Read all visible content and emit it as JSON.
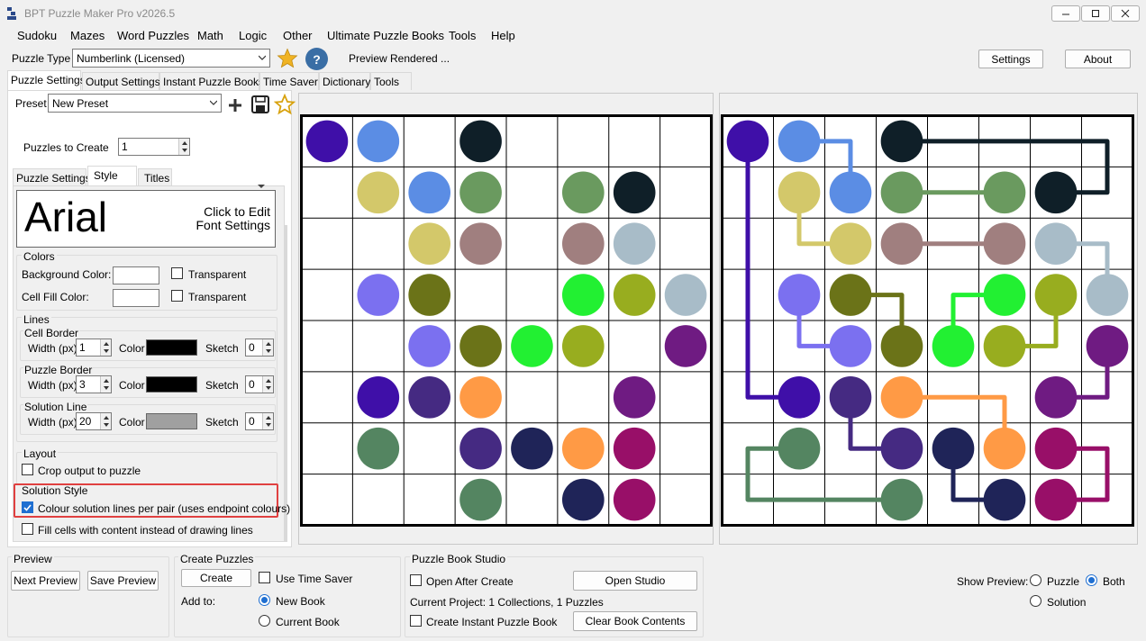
{
  "window": {
    "title": "BPT Puzzle Maker Pro v2026.5"
  },
  "menu": [
    "Sudoku",
    "Mazes",
    "Word Puzzles",
    "Math",
    "Logic",
    "Other",
    "Ultimate Puzzle Books",
    "Tools",
    "Help"
  ],
  "toolbar": {
    "puzzle_type_label": "Puzzle Type",
    "puzzle_type_value": "Numberlink (Licensed)",
    "status": "Preview Rendered ...",
    "settings": "Settings",
    "about": "About"
  },
  "main_tabs": [
    "Puzzle Settings",
    "Output Settings",
    "Instant Puzzle Books",
    "Time Saver",
    "Dictionary",
    "Tools"
  ],
  "preset": {
    "label": "Preset",
    "value": "New Preset"
  },
  "puzzles_to_create": {
    "label": "Puzzles to Create",
    "value": "1"
  },
  "sub_tabs": [
    "Puzzle Settings",
    "Style",
    "Titles"
  ],
  "font": {
    "sample": "Arial",
    "hint1": "Click to Edit",
    "hint2": "Font Settings"
  },
  "colors": {
    "title": "Colors",
    "bg_label": "Background Color:",
    "bg_transparent": "Transparent",
    "fill_label": "Cell Fill Color:",
    "fill_transparent": "Transparent"
  },
  "lines": {
    "title": "Lines",
    "width_label": "Width (px)",
    "color_label": "Color",
    "sketch_label": "Sketch",
    "cell_border": {
      "title": "Cell Border",
      "width": "1",
      "sketch": "0",
      "color": "#000000"
    },
    "puzzle_border": {
      "title": "Puzzle Border",
      "width": "3",
      "sketch": "0",
      "color": "#000000"
    },
    "solution_line": {
      "title": "Solution Line",
      "width": "20",
      "sketch": "0",
      "color": "#a0a0a0"
    }
  },
  "layout": {
    "title": "Layout",
    "crop": "Crop output to puzzle"
  },
  "solution_style": {
    "title": "Solution Style",
    "colour_lines": "Colour solution lines per pair (uses endpoint colours)"
  },
  "fill_cells": "Fill cells with content instead of drawing lines",
  "bottom": {
    "preview_title": "Preview",
    "next_preview": "Next Preview",
    "save_preview": "Save Preview",
    "create_title": "Create Puzzles",
    "create": "Create",
    "use_time_saver": "Use Time Saver",
    "add_to": "Add to:",
    "new_book": "New Book",
    "current_book": "Current Book",
    "studio_title": "Puzzle Book Studio",
    "open_after": "Open After Create",
    "open_studio": "Open Studio",
    "current_project": "Current Project: 1 Collections, 1 Puzzles",
    "create_instant": "Create Instant Puzzle Book",
    "clear_book": "Clear Book Contents",
    "show_preview": "Show Preview:",
    "opt_puzzle": "Puzzle",
    "opt_both": "Both",
    "opt_solution": "Solution"
  },
  "grid": {
    "rows": 8,
    "cols": 8
  },
  "dots": [
    [
      0,
      0,
      "#3f0fa8"
    ],
    [
      0,
      1,
      "#5b8de4"
    ],
    [
      0,
      3,
      "#0f1f28"
    ],
    [
      1,
      1,
      "#d3c86a"
    ],
    [
      1,
      2,
      "#5b8de4"
    ],
    [
      1,
      3,
      "#6a9a5f"
    ],
    [
      1,
      5,
      "#6a9a5f"
    ],
    [
      1,
      6,
      "#0f1f28"
    ],
    [
      2,
      2,
      "#d3c86a"
    ],
    [
      2,
      3,
      "#a07f7f"
    ],
    [
      2,
      5,
      "#a07f7f"
    ],
    [
      2,
      6,
      "#a8bcc8"
    ],
    [
      3,
      1,
      "#7b70f0"
    ],
    [
      3,
      2,
      "#6b7318"
    ],
    [
      3,
      5,
      "#22f032"
    ],
    [
      3,
      6,
      "#98ad1f"
    ],
    [
      3,
      7,
      "#a8bcc8"
    ],
    [
      4,
      2,
      "#7b70f0"
    ],
    [
      4,
      3,
      "#6b7318"
    ],
    [
      4,
      4,
      "#22f032"
    ],
    [
      4,
      5,
      "#98ad1f"
    ],
    [
      4,
      7,
      "#6f1b82"
    ],
    [
      5,
      1,
      "#3f0fa8"
    ],
    [
      5,
      2,
      "#452a82"
    ],
    [
      5,
      3,
      "#ff9a45"
    ],
    [
      5,
      6,
      "#6f1b82"
    ],
    [
      6,
      1,
      "#548561"
    ],
    [
      6,
      3,
      "#452a82"
    ],
    [
      6,
      4,
      "#1f2458"
    ],
    [
      6,
      5,
      "#ff9a45"
    ],
    [
      6,
      6,
      "#980f68"
    ],
    [
      7,
      3,
      "#548561"
    ],
    [
      7,
      5,
      "#1f2458"
    ],
    [
      7,
      6,
      "#980f68"
    ]
  ],
  "paths": [
    {
      "color": "#3f0fa8",
      "cells": [
        [
          0,
          0
        ],
        [
          1,
          0
        ],
        [
          2,
          0
        ],
        [
          3,
          0
        ],
        [
          4,
          0
        ],
        [
          5,
          0
        ],
        [
          5,
          1
        ]
      ]
    },
    {
      "color": "#5b8de4",
      "cells": [
        [
          0,
          1
        ],
        [
          0,
          2
        ],
        [
          1,
          2
        ]
      ]
    },
    {
      "color": "#0f1f28",
      "cells": [
        [
          0,
          3
        ],
        [
          0,
          4
        ],
        [
          0,
          5
        ],
        [
          0,
          6
        ],
        [
          0,
          7
        ],
        [
          1,
          7
        ],
        [
          1,
          6
        ]
      ]
    },
    {
      "color": "#d3c86a",
      "cells": [
        [
          1,
          1
        ],
        [
          2,
          1
        ],
        [
          2,
          2
        ]
      ]
    },
    {
      "color": "#6a9a5f",
      "cells": [
        [
          1,
          3
        ],
        [
          1,
          4
        ],
        [
          1,
          5
        ]
      ]
    },
    {
      "color": "#a07f7f",
      "cells": [
        [
          2,
          3
        ],
        [
          2,
          4
        ],
        [
          2,
          5
        ]
      ]
    },
    {
      "color": "#a8bcc8",
      "cells": [
        [
          2,
          6
        ],
        [
          2,
          7
        ],
        [
          3,
          7
        ]
      ]
    },
    {
      "color": "#7b70f0",
      "cells": [
        [
          3,
          1
        ],
        [
          4,
          1
        ],
        [
          4,
          2
        ]
      ]
    },
    {
      "color": "#6b7318",
      "cells": [
        [
          3,
          2
        ],
        [
          3,
          3
        ],
        [
          4,
          3
        ]
      ]
    },
    {
      "color": "#22f032",
      "cells": [
        [
          3,
          5
        ],
        [
          3,
          4
        ],
        [
          4,
          4
        ]
      ]
    },
    {
      "color": "#98ad1f",
      "cells": [
        [
          3,
          6
        ],
        [
          4,
          6
        ],
        [
          4,
          5
        ]
      ]
    },
    {
      "color": "#6f1b82",
      "cells": [
        [
          4,
          7
        ],
        [
          5,
          7
        ],
        [
          5,
          6
        ]
      ]
    },
    {
      "color": "#452a82",
      "cells": [
        [
          5,
          2
        ],
        [
          6,
          2
        ],
        [
          6,
          3
        ]
      ]
    },
    {
      "color": "#ff9a45",
      "cells": [
        [
          5,
          3
        ],
        [
          5,
          4
        ],
        [
          5,
          5
        ],
        [
          6,
          5
        ]
      ]
    },
    {
      "color": "#548561",
      "cells": [
        [
          6,
          1
        ],
        [
          6,
          0
        ],
        [
          7,
          0
        ],
        [
          7,
          1
        ],
        [
          7,
          2
        ],
        [
          7,
          3
        ]
      ]
    },
    {
      "color": "#1f2458",
      "cells": [
        [
          6,
          4
        ],
        [
          7,
          4
        ],
        [
          7,
          5
        ]
      ]
    },
    {
      "color": "#980f68",
      "cells": [
        [
          6,
          6
        ],
        [
          6,
          7
        ],
        [
          7,
          7
        ],
        [
          7,
          6
        ]
      ]
    }
  ]
}
